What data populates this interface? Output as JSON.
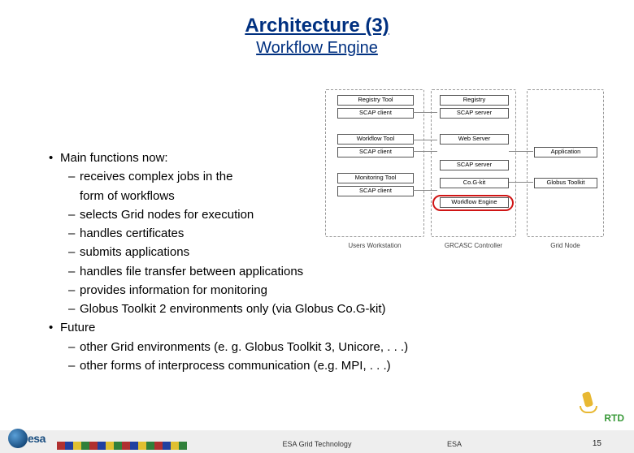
{
  "title": "Architecture (3)",
  "subtitle": "Workflow Engine",
  "bullets": {
    "b1": "Main functions now:",
    "s1": "receives complex jobs in the form of workflows",
    "s2": "selects Grid nodes for execution",
    "s3": "handles certificates",
    "s4": "submits applications",
    "s5": "handles file transfer between applications",
    "s6": "provides information for monitoring",
    "s7": "Globus Toolkit 2 environments only (via Globus Co.G-kit)",
    "b2": "Future",
    "s8": "other Grid environments (e. g. Globus Toolkit 3, Unicore, . . .)",
    "s9": "other forms of interprocess communication (e.g. MPI, . . .)"
  },
  "diagram": {
    "col1_label": "Users Workstation",
    "col2_label": "GRCASC Controller",
    "col3_label": "Grid Node",
    "col1": {
      "b1": "Registry Tool",
      "b2": "SCAP client",
      "b3": "Workflow Tool",
      "b4": "SCAP client",
      "b5": "Monitoring Tool",
      "b6": "SCAP client"
    },
    "col2": {
      "b1": "Registry",
      "b2": "SCAP server",
      "b3": "Web Server",
      "b4": "SCAP server",
      "b5": "Co.G-kit",
      "b6": "Workflow Engine"
    },
    "col3": {
      "b1": "Application",
      "b2": "Globus Toolkit"
    }
  },
  "footer": {
    "mid": "ESA Grid Technology",
    "esa": "ESA",
    "page": "15",
    "logo_text": "esa",
    "rtd": "RTD"
  }
}
